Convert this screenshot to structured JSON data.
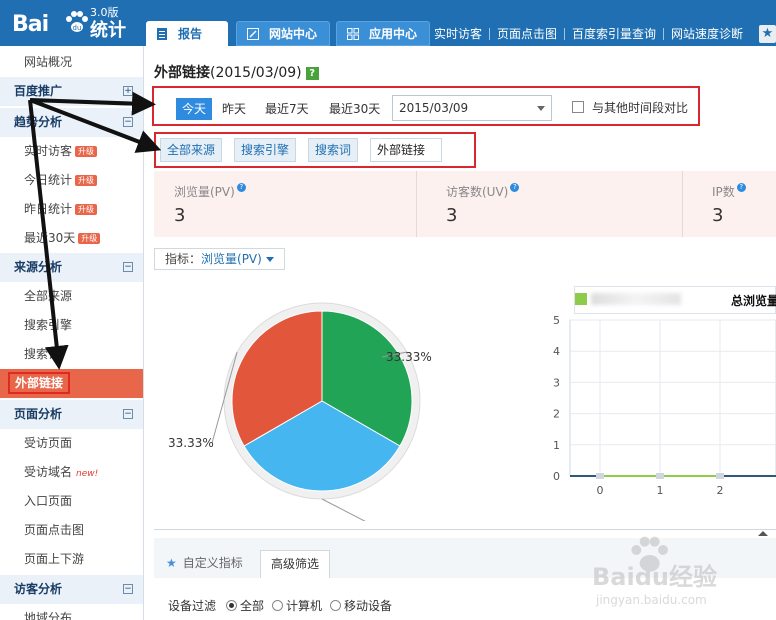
{
  "logo": {
    "brand": "Bai",
    "product": "统计",
    "version": "3.0版"
  },
  "topnav": {
    "tabs": [
      {
        "label": "报告"
      },
      {
        "label": "网站中心"
      },
      {
        "label": "应用中心"
      }
    ],
    "links": [
      "实时访客",
      "页面点击图",
      "百度索引量查询",
      "网站速度诊断"
    ]
  },
  "sidebar": {
    "overview": "网站概况",
    "promo": "百度推广",
    "trend": {
      "title": "趋势分析",
      "items": [
        {
          "label": "实时访客",
          "badge": "升级"
        },
        {
          "label": "今日统计",
          "badge": "升级"
        },
        {
          "label": "昨日统计",
          "badge": "升级"
        },
        {
          "label": "最近30天",
          "badge": "升级"
        }
      ]
    },
    "source": {
      "title": "来源分析",
      "items": [
        "全部来源",
        "搜索引擎",
        "搜索词",
        "外部链接"
      ]
    },
    "page": {
      "title": "页面分析",
      "items": [
        {
          "label": "受访页面",
          "tag": ""
        },
        {
          "label": "受访域名",
          "tag": "new!"
        },
        {
          "label": "入口页面",
          "tag": ""
        },
        {
          "label": "页面点击图",
          "tag": ""
        },
        {
          "label": "页面上下游",
          "tag": ""
        }
      ]
    },
    "visitor": {
      "title": "访客分析",
      "items": [
        "地域分布"
      ]
    }
  },
  "main": {
    "title": "外部链接",
    "title_date": "(2015/03/09)",
    "help": "?",
    "date_buttons": [
      "今天",
      "昨天",
      "最近7天",
      "最近30天"
    ],
    "date_value": "2015/03/09",
    "compare_label": "与其他时间段对比",
    "source_tabs": [
      "全部来源",
      "搜索引擎",
      "搜索词",
      "外部链接"
    ],
    "metrics": [
      {
        "label": "浏览量(PV)",
        "value": "3"
      },
      {
        "label": "访客数(UV)",
        "value": "3"
      },
      {
        "label": "IP数",
        "value": "3"
      }
    ],
    "indicator_label": "指标：",
    "indicator_value": "浏览量(PV)",
    "bottom_tabs": [
      "自定义指标",
      "高级筛选"
    ],
    "filter": {
      "label": "设备过滤",
      "options": [
        "全部",
        "计算机",
        "移动设备"
      ],
      "selected": "全部"
    }
  },
  "chart_data": [
    {
      "type": "pie",
      "categories": [
        "",
        "",
        ""
      ],
      "values": [
        33.33,
        33.33,
        33.33
      ],
      "labels": [
        "33.33%",
        "33.33%",
        "33.33%"
      ],
      "colors": [
        "#22a457",
        "#45b6ef",
        "#e2573c"
      ]
    },
    {
      "type": "line",
      "title": "总浏览量",
      "x": [
        0,
        1,
        2
      ],
      "series": [
        {
          "values": [
            0,
            0,
            0
          ]
        }
      ],
      "ylim": [
        0,
        5
      ],
      "yticks": [
        "5",
        "4",
        "3",
        "2",
        "1",
        "0"
      ],
      "xticks": [
        "0",
        "1",
        "2"
      ],
      "color": "#8fcb4b",
      "grid": true
    }
  ],
  "watermark": {
    "text": "Baidu经验",
    "url": "jingyan.baidu.com"
  }
}
